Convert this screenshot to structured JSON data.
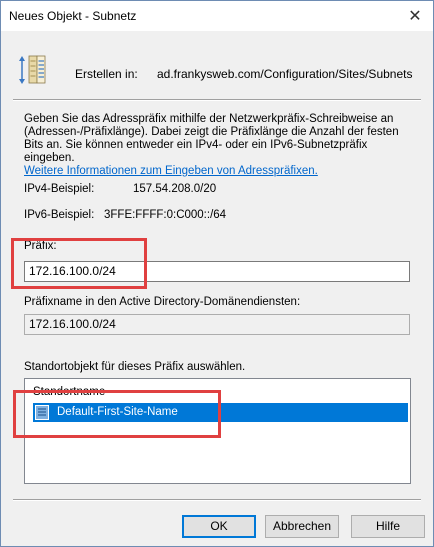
{
  "window": {
    "title": "Neues Objekt - Subnetz",
    "close_glyph": "✕"
  },
  "header": {
    "icon": "subnet-object-icon",
    "create_label": "Erstellen in:",
    "create_path": "ad.frankysweb.com/Configuration/Sites/Subnets"
  },
  "description": {
    "text": "Geben Sie das Adresspräfix mithilfe der Netzwerkpräfix-Schreibweise an (Adressen-/Präfixlänge). Dabei zeigt die Präfixlänge die Anzahl der festen Bits an. Sie können entweder ein IPv4- oder ein IPv6-Subnetzpräfix eingeben.",
    "link": "Weitere Informationen zum Eingeben von Adresspräfixen."
  },
  "examples": {
    "ipv4_label": "IPv4-Beispiel:",
    "ipv4_value": "157.54.208.0/20",
    "ipv6_label": "IPv6-Beispiel:",
    "ipv6_value": "3FFE:FFFF:0:C000::/64"
  },
  "prefix": {
    "label": "Präfix:",
    "value": "172.16.100.0/24"
  },
  "prefix_name": {
    "label": "Präfixname in den Active Directory-Domänendiensten:",
    "value": "172.16.100.0/24"
  },
  "site_select": {
    "label": "Standortobjekt für dieses Präfix auswählen.",
    "column_header": "Standortname",
    "items": [
      "Default-First-Site-Name"
    ],
    "selected_index": 0
  },
  "buttons": {
    "ok": "OK",
    "cancel": "Abbrechen",
    "help": "Hilfe"
  },
  "colors": {
    "selection": "#0078d7",
    "highlight_annotation": "#e04040",
    "link": "#0066cc"
  }
}
